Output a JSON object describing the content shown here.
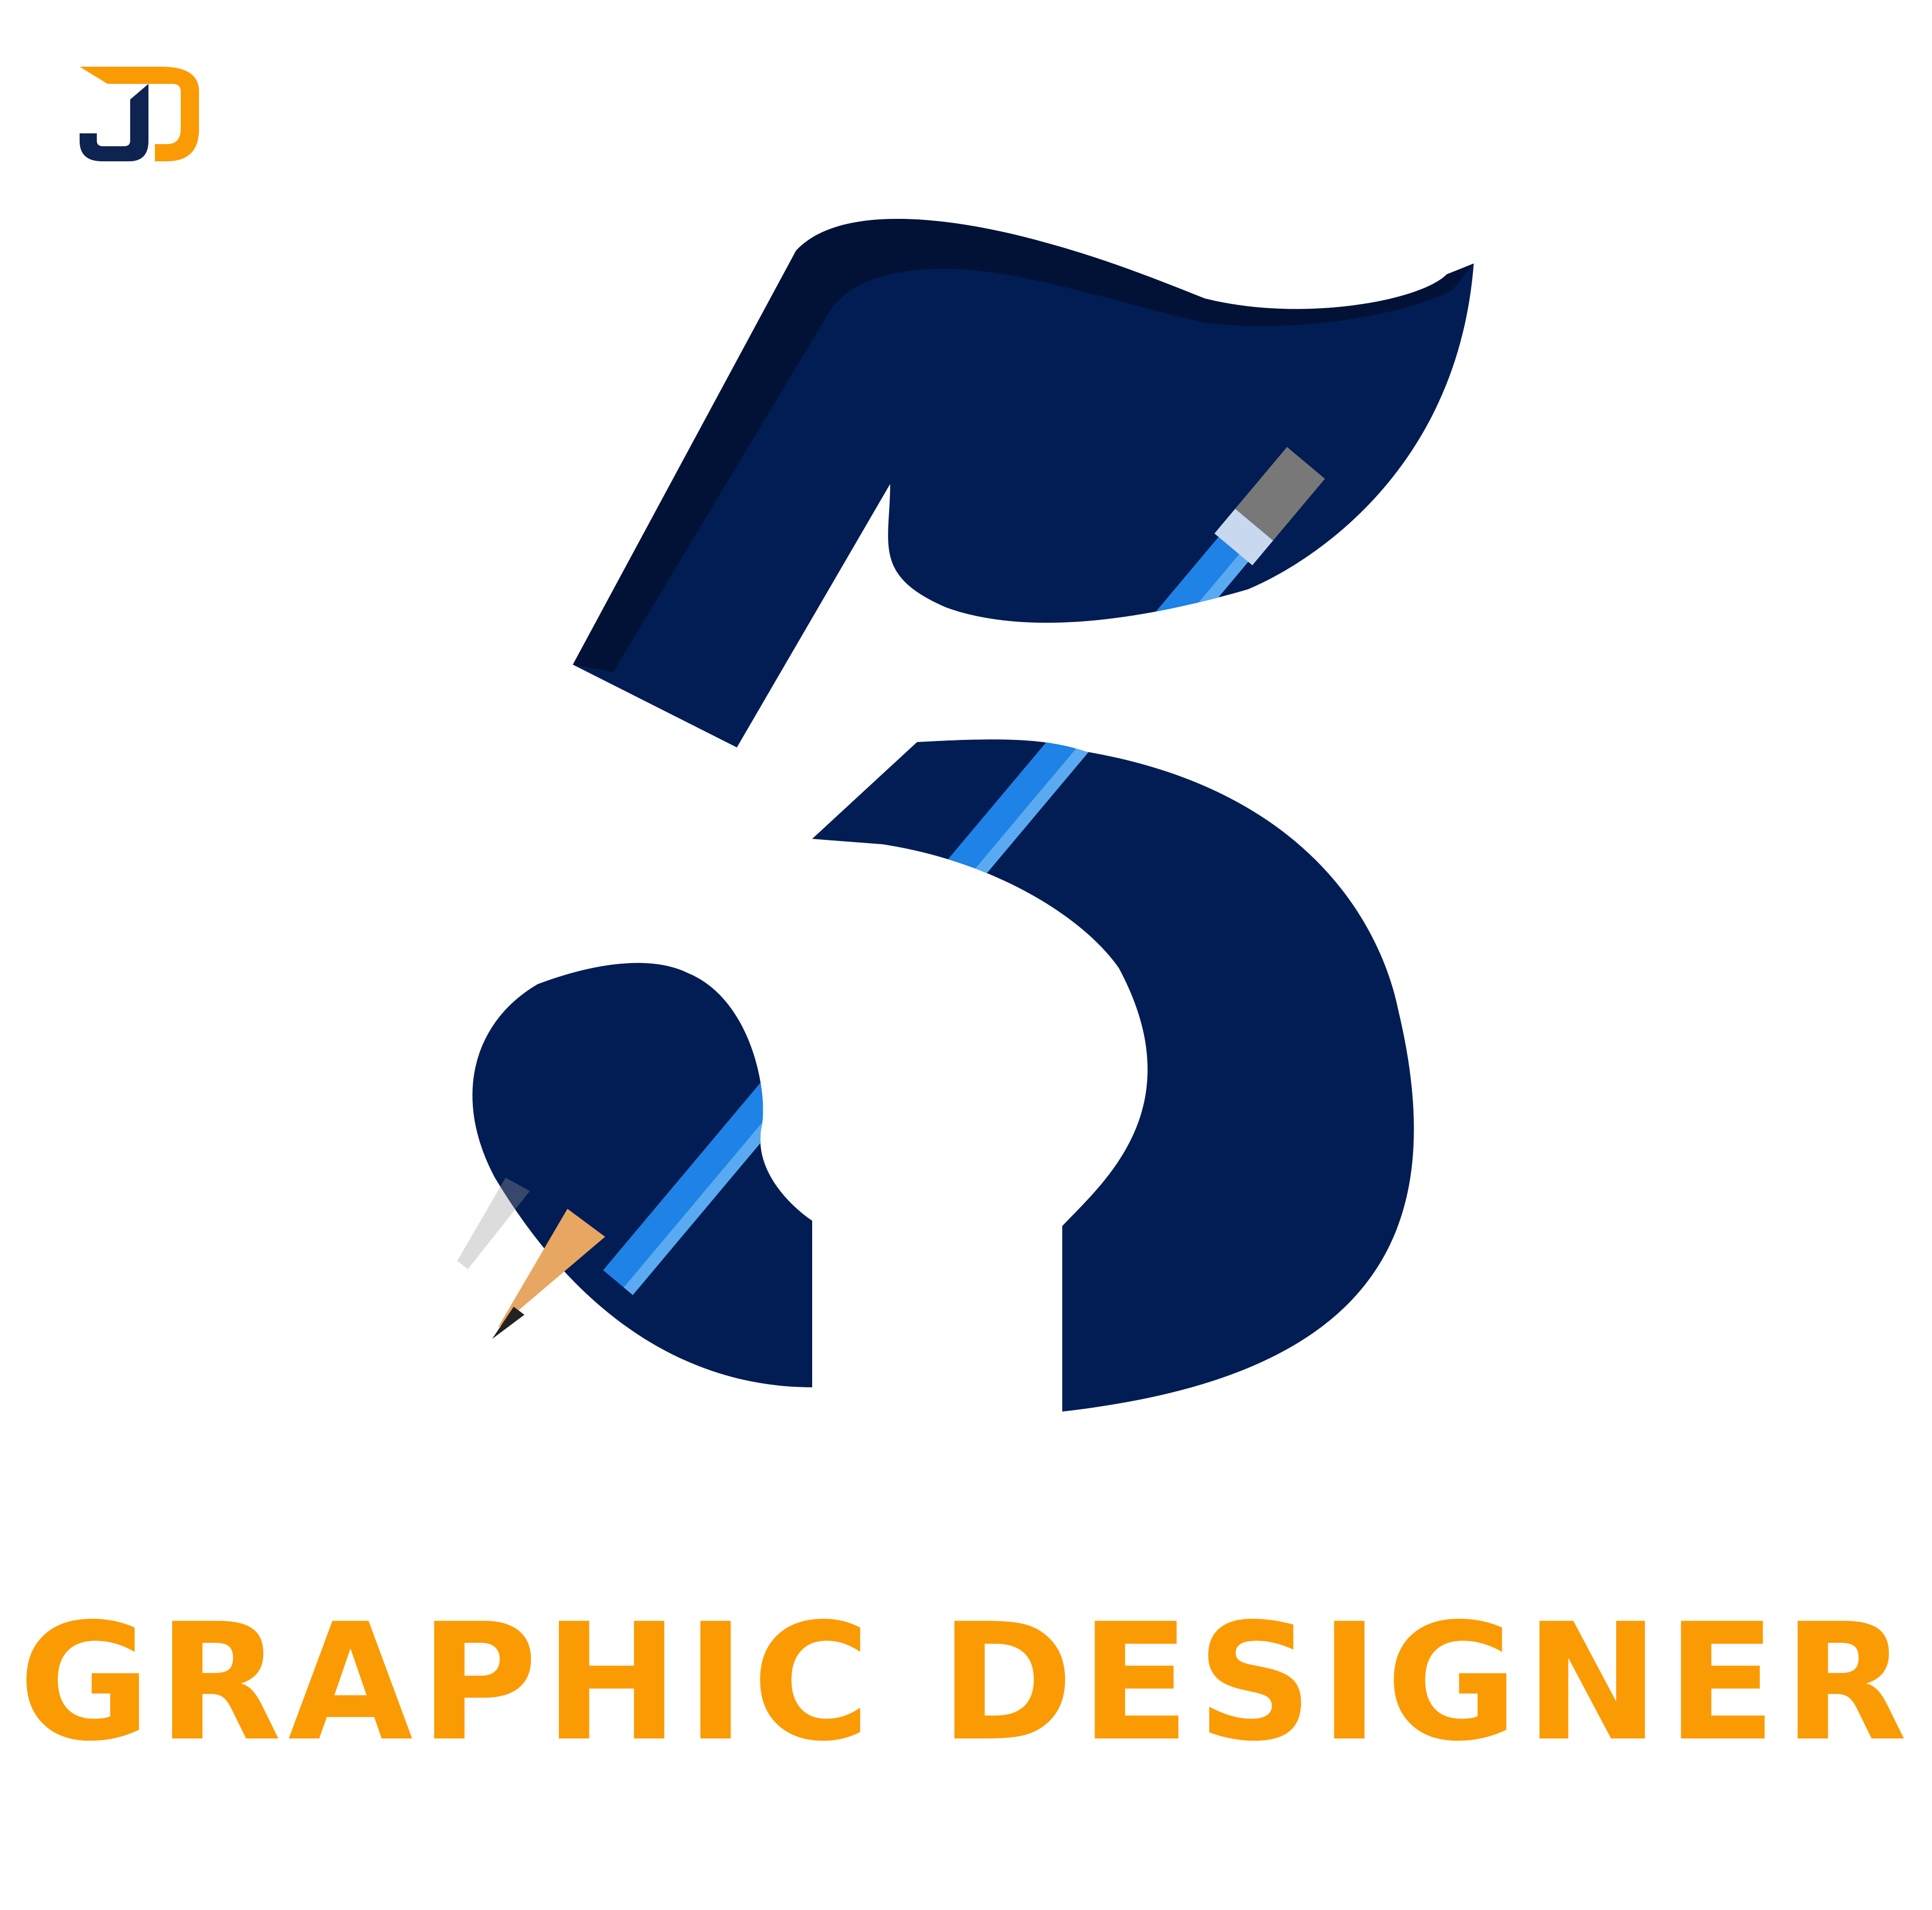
{
  "logo": {
    "name": "jd-monogram",
    "colors": {
      "navy": "#0f2350",
      "orange": "#fb9b04"
    }
  },
  "hero": {
    "numeral": "5",
    "numeral_color": "#021d53",
    "pencil": {
      "name": "pencil-icon",
      "body_color": "#1e82e6",
      "highlight_color": "#5aaaf2",
      "wood_color": "#e7a763",
      "eraser_band_color": "#787878"
    }
  },
  "headline": {
    "text": "GRAPHIC DESIGNER",
    "color": "#fb9b04"
  },
  "background_color": "#ffffff"
}
